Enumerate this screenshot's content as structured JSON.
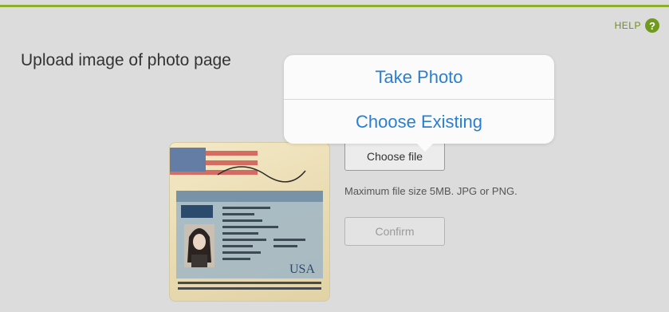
{
  "header": {
    "help_label": "HELP",
    "help_icon": "help-circle-icon",
    "accent_color": "#8fae2a"
  },
  "main": {
    "title": "Upload image of photo page",
    "choose_file_label": "Choose file",
    "file_hint": "Maximum file size 5MB. JPG or PNG.",
    "confirm_label": "Confirm"
  },
  "popover": {
    "take_photo_label": "Take Photo",
    "choose_existing_label": "Choose Existing",
    "link_color": "#2a7fd1"
  },
  "passport_image": {
    "country_code": "USA"
  }
}
